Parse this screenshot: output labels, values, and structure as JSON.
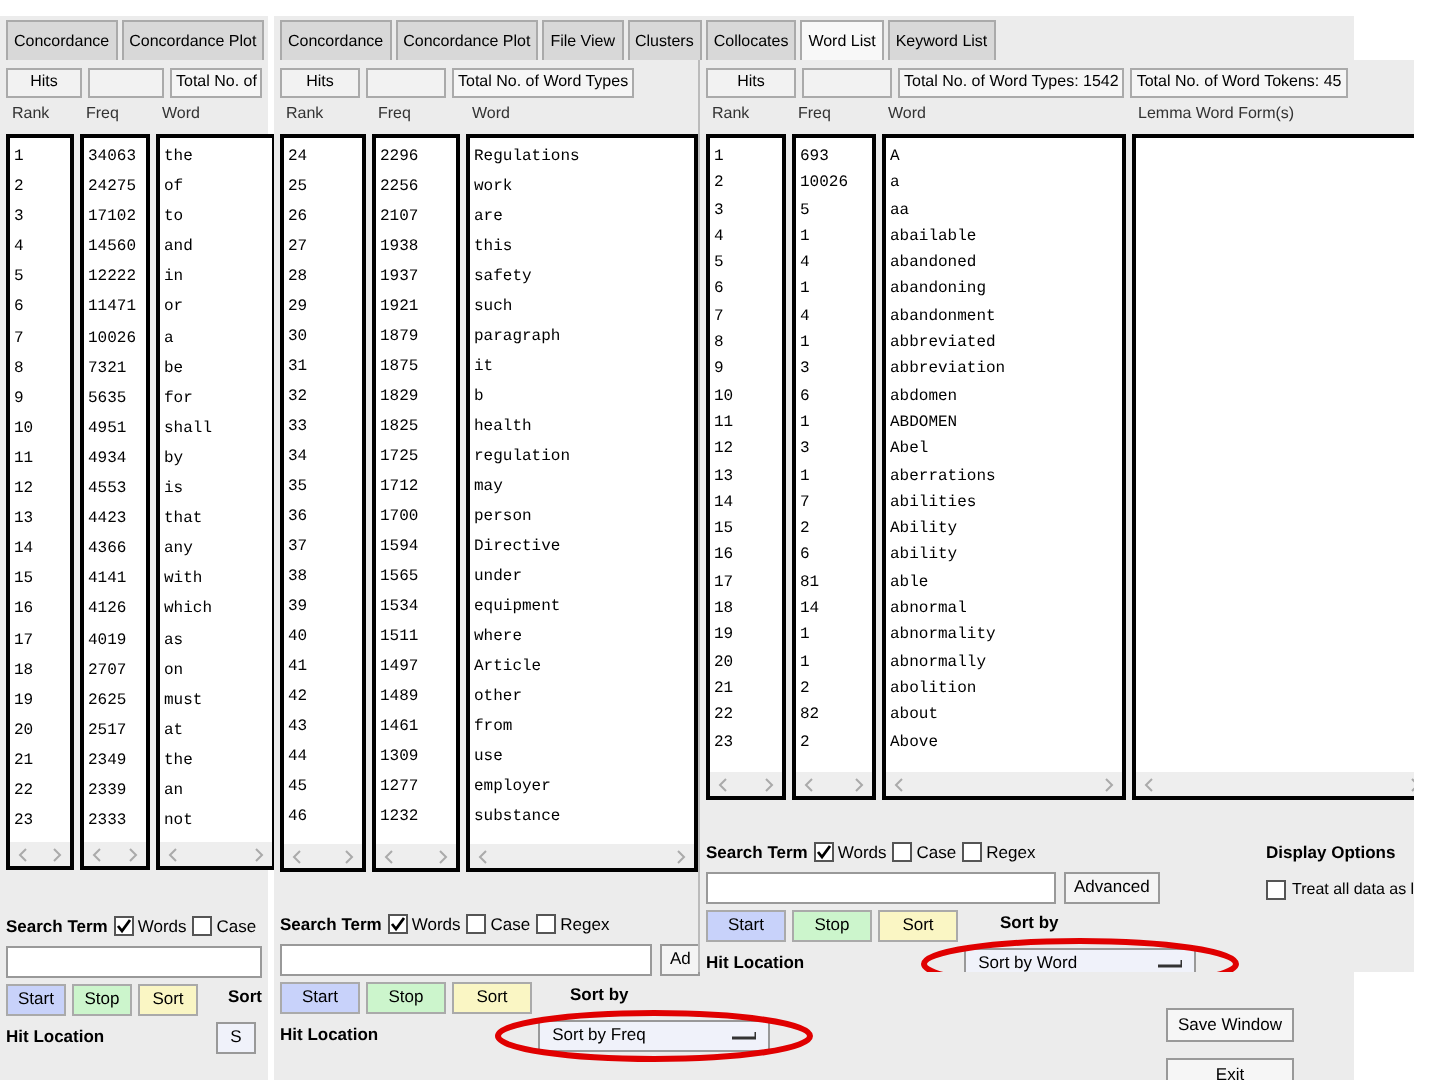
{
  "windows": [
    {
      "tabs": [
        {
          "label": "Concordance",
          "selected": false
        },
        {
          "label": "Concordance Plot",
          "selected": false
        }
      ],
      "hits": "Hits",
      "totals": [
        "Total No. of"
      ],
      "columns": [
        "Rank",
        "Freq",
        "Word"
      ],
      "rows": [
        [
          "1",
          "34063",
          "the"
        ],
        [
          "2",
          "24275",
          "of"
        ],
        [
          "3",
          "17102",
          "to"
        ],
        [
          "4",
          "14560",
          "and"
        ],
        [
          "5",
          "12222",
          "in"
        ],
        [
          "6",
          "11471",
          "or"
        ],
        [
          "7",
          "10026",
          "a"
        ],
        [
          "8",
          "7321",
          "be"
        ],
        [
          "9",
          "5635",
          "for"
        ],
        [
          "10",
          "4951",
          "shall"
        ],
        [
          "11",
          "4934",
          "by"
        ],
        [
          "12",
          "4553",
          "is"
        ],
        [
          "13",
          "4423",
          "that"
        ],
        [
          "14",
          "4366",
          "any"
        ],
        [
          "15",
          "4141",
          "with"
        ],
        [
          "16",
          "4126",
          "which"
        ],
        [
          "17",
          "4019",
          "as"
        ],
        [
          "18",
          "2707",
          "on"
        ],
        [
          "19",
          "2625",
          "must"
        ],
        [
          "20",
          "2517",
          "at"
        ],
        [
          "21",
          "2349",
          "the"
        ],
        [
          "22",
          "2339",
          "an"
        ],
        [
          "23",
          "2333",
          "not"
        ]
      ],
      "search": {
        "label": "Search Term",
        "options": [
          {
            "label": "Words",
            "checked": true
          },
          {
            "label": "Case",
            "checked": false
          }
        ]
      },
      "buttons": [
        {
          "label": "Start",
          "kind": "start"
        },
        {
          "label": "Stop",
          "kind": "stop"
        },
        {
          "label": "Sort",
          "kind": "sort"
        }
      ],
      "sort_label": "Sort",
      "sort_button": "S",
      "sort_highlighted": false,
      "hit_location": "Hit Location"
    },
    {
      "tabs": [
        {
          "label": "Concordance",
          "selected": false
        },
        {
          "label": "Concordance Plot",
          "selected": false
        },
        {
          "label": "File View",
          "selected": false
        },
        {
          "label": "Clusters",
          "selected": false
        },
        {
          "label": "Collocates",
          "selected": false
        },
        {
          "label": "Word List",
          "selected": true
        },
        {
          "label": "Keyword List",
          "selected": false
        }
      ],
      "hits": "Hits",
      "totals": [
        "Total No. of Word Types"
      ],
      "columns": [
        "Rank",
        "Freq",
        "Word"
      ],
      "rows": [
        [
          "24",
          "2296",
          "Regulations"
        ],
        [
          "25",
          "2256",
          "work"
        ],
        [
          "26",
          "2107",
          "are"
        ],
        [
          "27",
          "1938",
          "this"
        ],
        [
          "28",
          "1937",
          "safety"
        ],
        [
          "29",
          "1921",
          "such"
        ],
        [
          "30",
          "1879",
          "paragraph"
        ],
        [
          "31",
          "1875",
          "it"
        ],
        [
          "32",
          "1829",
          "b"
        ],
        [
          "33",
          "1825",
          "health"
        ],
        [
          "34",
          "1725",
          "regulation"
        ],
        [
          "35",
          "1712",
          "may"
        ],
        [
          "36",
          "1700",
          "person"
        ],
        [
          "37",
          "1594",
          "Directive"
        ],
        [
          "38",
          "1565",
          "under"
        ],
        [
          "39",
          "1534",
          "equipment"
        ],
        [
          "40",
          "1511",
          "where"
        ],
        [
          "41",
          "1497",
          "Article"
        ],
        [
          "42",
          "1489",
          "other"
        ],
        [
          "43",
          "1461",
          "from"
        ],
        [
          "44",
          "1309",
          "use"
        ],
        [
          "45",
          "1277",
          "employer"
        ],
        [
          "46",
          "1232",
          "substance"
        ]
      ],
      "search": {
        "label": "Search Term",
        "options": [
          {
            "label": "Words",
            "checked": true
          },
          {
            "label": "Case",
            "checked": false
          },
          {
            "label": "Regex",
            "checked": false
          }
        ]
      },
      "advanced": "Ad",
      "buttons": [
        {
          "label": "Start",
          "kind": "start"
        },
        {
          "label": "Stop",
          "kind": "stop"
        },
        {
          "label": "Sort",
          "kind": "sort"
        }
      ],
      "sort_label": "Sort by",
      "sort_button": "Sort by Freq",
      "sort_highlighted": true,
      "hit_location": "Hit Location",
      "side_buttons": [
        "Save Window",
        "Exit"
      ]
    },
    {
      "hits": "Hits",
      "totals": [
        "Total No. of Word Types: 1542",
        "Total No. of Word Tokens: 45"
      ],
      "columns": [
        "Rank",
        "Freq",
        "Word",
        "Lemma Word Form(s)"
      ],
      "rows": [
        [
          "1",
          "693",
          "A"
        ],
        [
          "2",
          "10026",
          "a"
        ],
        [
          "3",
          "5",
          "aa"
        ],
        [
          "4",
          "1",
          "abailable"
        ],
        [
          "5",
          "4",
          "abandoned"
        ],
        [
          "6",
          "1",
          "abandoning"
        ],
        [
          "7",
          "4",
          "abandonment"
        ],
        [
          "8",
          "1",
          "abbreviated"
        ],
        [
          "9",
          "3",
          "abbreviation"
        ],
        [
          "10",
          "6",
          "abdomen"
        ],
        [
          "11",
          "1",
          "ABDOMEN"
        ],
        [
          "12",
          "3",
          "Abel"
        ],
        [
          "13",
          "1",
          "aberrations"
        ],
        [
          "14",
          "7",
          "abilities"
        ],
        [
          "15",
          "2",
          "Ability"
        ],
        [
          "16",
          "6",
          "ability"
        ],
        [
          "17",
          "81",
          "able"
        ],
        [
          "18",
          "14",
          "abnormal"
        ],
        [
          "19",
          "1",
          "abnormality"
        ],
        [
          "20",
          "1",
          "abnormally"
        ],
        [
          "21",
          "2",
          "abolition"
        ],
        [
          "22",
          "82",
          "about"
        ],
        [
          "23",
          "2",
          "Above"
        ]
      ],
      "search": {
        "label": "Search Term",
        "options": [
          {
            "label": "Words",
            "checked": true
          },
          {
            "label": "Case",
            "checked": false
          },
          {
            "label": "Regex",
            "checked": false
          }
        ]
      },
      "advanced": "Advanced",
      "buttons": [
        {
          "label": "Start",
          "kind": "start"
        },
        {
          "label": "Stop",
          "kind": "stop"
        },
        {
          "label": "Sort",
          "kind": "sort"
        }
      ],
      "sort_label": "Sort by",
      "sort_button": "Sort by Word",
      "sort_highlighted": true,
      "hit_location": "Hit Location",
      "display_options": {
        "label": "Display Options",
        "option": {
          "label": "Treat all data as l",
          "checked": false
        }
      }
    }
  ]
}
